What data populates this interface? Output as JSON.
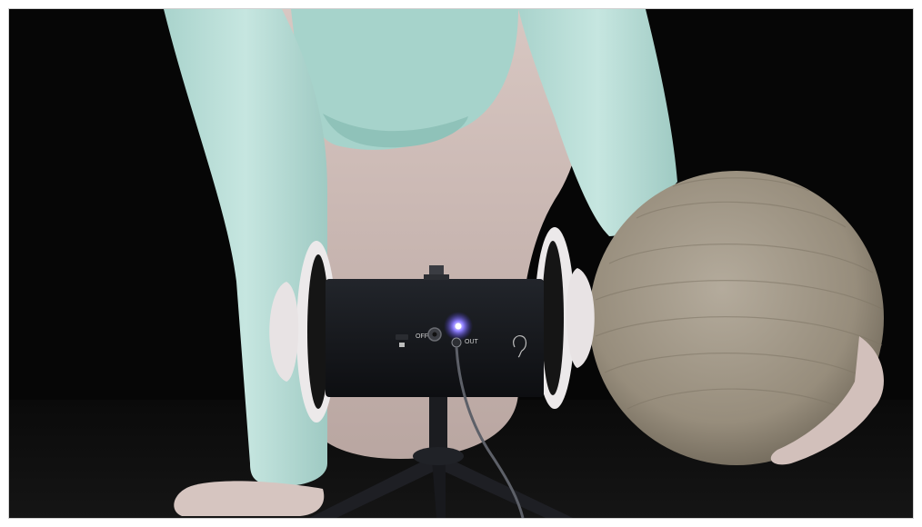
{
  "image": {
    "kind": "video-frame",
    "background_color": "#070707",
    "frame_color": "#ffffff"
  },
  "microphone": {
    "switch_off_label": "OFF",
    "output_label": "OUT",
    "led_color": "#7a6cff",
    "body_color": "#15171c",
    "ear_color": "#ece9ea"
  },
  "ball": {
    "color": "#9d9383"
  }
}
